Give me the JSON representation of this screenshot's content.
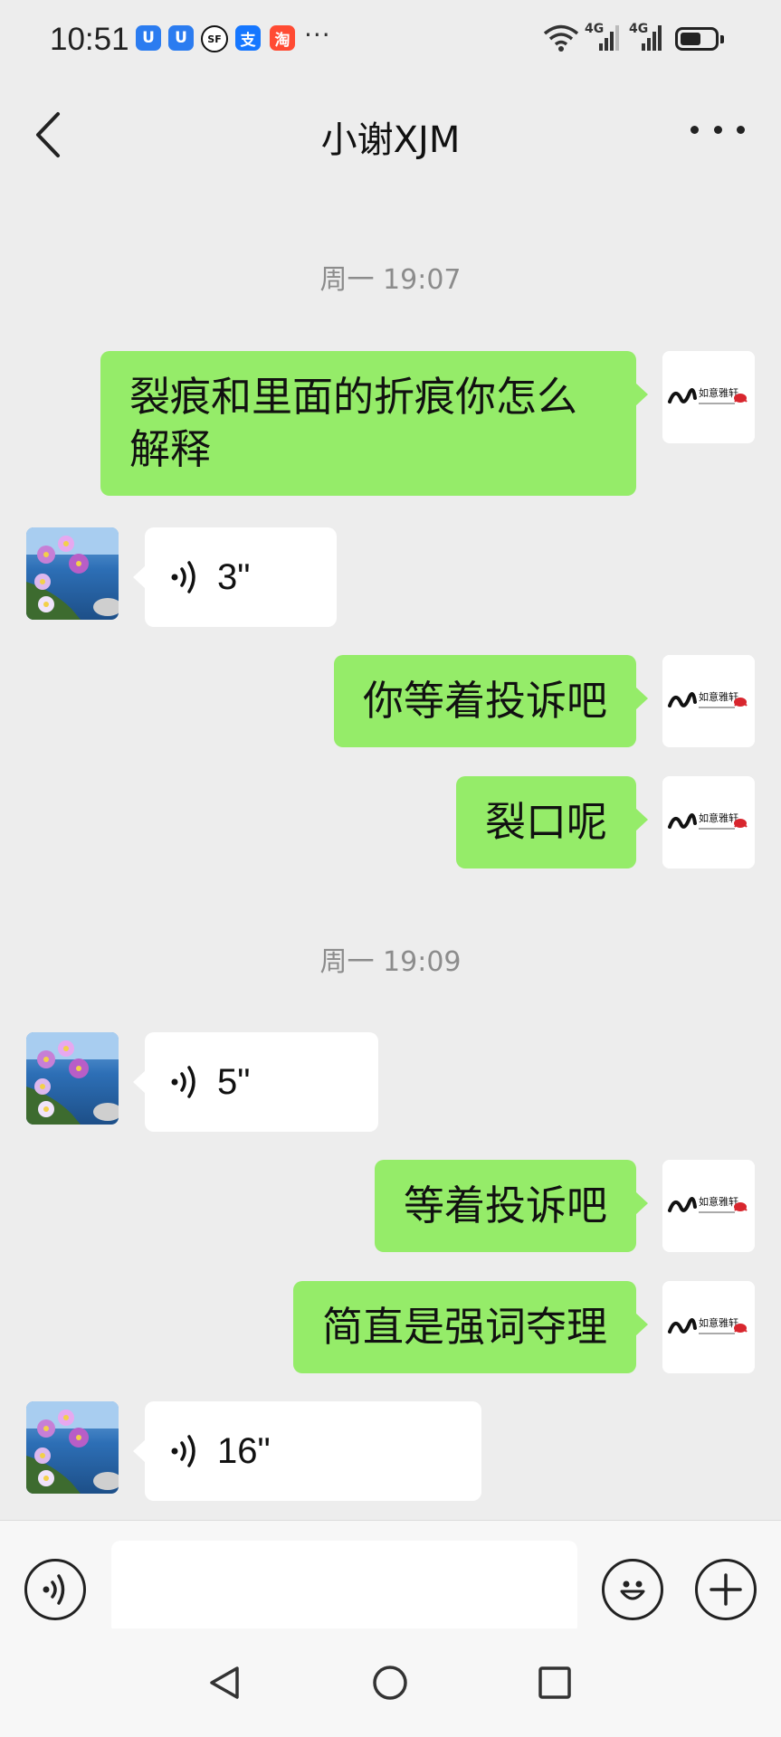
{
  "status_bar": {
    "time": "10:51",
    "notification_icons": [
      {
        "name": "shield-u-icon",
        "glyph": "U",
        "color": "#2b7cf0"
      },
      {
        "name": "shield-u-icon",
        "glyph": "U",
        "color": "#2b7cf0"
      },
      {
        "name": "sf-express-icon",
        "glyph": "SF",
        "color": "#111111"
      },
      {
        "name": "alipay-icon",
        "glyph": "支",
        "color": "#1677ff"
      },
      {
        "name": "taobao-icon",
        "glyph": "淘",
        "color": "#ff4b33"
      }
    ],
    "more_indicator": "···",
    "network_1": "4G",
    "network_2": "4G"
  },
  "header": {
    "title": "小谢XJM"
  },
  "chat": {
    "timestamps": [
      "周一 19:07",
      "周一 19:09"
    ],
    "sent_messages": [
      "裂痕和里面的折痕你怎么解释",
      "你等着投诉吧",
      "裂口呢",
      "等着投诉吧",
      "简直是强词夺理"
    ],
    "voice_messages": [
      {
        "duration": "3\""
      },
      {
        "duration": "5\""
      },
      {
        "duration": "16\""
      }
    ],
    "self_avatar_text": "如意雅轩"
  },
  "colors": {
    "sent_bubble": "#95ec69",
    "received_bubble": "#ffffff",
    "background": "#ededed"
  }
}
